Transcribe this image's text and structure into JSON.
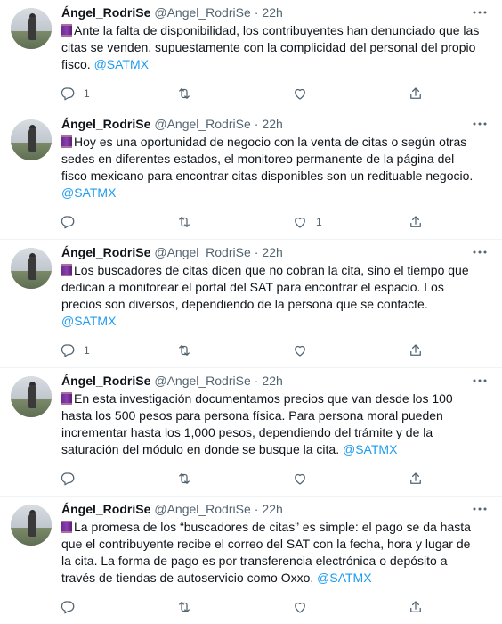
{
  "tweets": [
    {
      "name": "Ángel_RodriSe",
      "handle": "@Angel_RodriSe",
      "time": "22h",
      "text": "Ante la falta de disponibilidad, los contribuyentes han denunciado que las citas se venden, supuestamente con la complicidad del personal del propio fisco.",
      "mention": "@SATMX",
      "reply_count": "1",
      "retweet_count": "",
      "like_count": ""
    },
    {
      "name": "Ángel_RodriSe",
      "handle": "@Angel_RodriSe",
      "time": "22h",
      "text": "Hoy es una oportunidad de negocio con la venta de citas o según otras sedes en diferentes estados, el monitoreo permanente de la página del fisco mexicano para encontrar citas disponibles son un redituable negocio.",
      "mention": "@SATMX",
      "reply_count": "",
      "retweet_count": "",
      "like_count": "1"
    },
    {
      "name": "Ángel_RodriSe",
      "handle": "@Angel_RodriSe",
      "time": "22h",
      "text": "Los buscadores de citas dicen que no cobran la cita, sino el tiempo que dedican a monitorear el portal del SAT para encontrar el espacio. Los precios son diversos, dependiendo de la persona que se contacte.",
      "mention": "@SATMX",
      "reply_count": "1",
      "retweet_count": "",
      "like_count": ""
    },
    {
      "name": "Ángel_RodriSe",
      "handle": "@Angel_RodriSe",
      "time": "22h",
      "text": "En esta investigación documentamos precios que van desde los 100 hasta los 500 pesos para persona física. Para persona moral pueden incrementar hasta los 1,000 pesos, dependiendo del trámite y de la saturación del módulo en donde se busque la cita.",
      "mention": "@SATMX",
      "reply_count": "",
      "retweet_count": "",
      "like_count": ""
    },
    {
      "name": "Ángel_RodriSe",
      "handle": "@Angel_RodriSe",
      "time": "22h",
      "text": "La promesa de los “buscadores de citas” es simple: el pago se da hasta que el contribuyente recibe el correo del SAT con la fecha, hora y lugar de la cita. La forma de pago es por transferencia electrónica o depósito a través de tiendas de autoservicio como Oxxo.",
      "mention": "@SATMX",
      "reply_count": "",
      "retweet_count": "",
      "like_count": ""
    }
  ],
  "separator": "·",
  "icons": {
    "emoji": "spool-of-thread-emoji",
    "more": "more-dots-icon",
    "reply": "reply-icon",
    "retweet": "retweet-icon",
    "like": "heart-icon",
    "share": "share-icon"
  },
  "colors": {
    "link": "#1d9bf0",
    "secondary": "#536471",
    "text": "#0f1419"
  }
}
